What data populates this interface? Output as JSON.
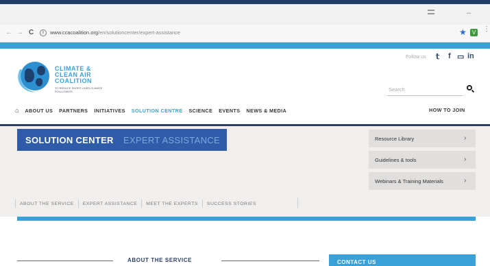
{
  "browser": {
    "url_domain": "www.ccacoalition.org",
    "url_path": "/en/solutioncenter/expert-assistance"
  },
  "site": {
    "follow_us": "Follow us",
    "logo": {
      "line1": "CLIMATE &",
      "line2": "CLEAN AIR",
      "line3": "COALITION",
      "tagline": "TO REDUCE SHORT-LIVED CLIMATE POLLUTANTS"
    },
    "search_placeholder": "Search",
    "nav": [
      "ABOUT US",
      "PARTNERS",
      "INITIATIVES",
      "SOLUTION CENTRE",
      "SCIENCE",
      "EVENTS",
      "NEWS & MEDIA"
    ],
    "how_to_join": "HOW TO JOIN"
  },
  "hero": {
    "title": "SOLUTION CENTER",
    "subtitle": "EXPERT ASSISTANCE"
  },
  "side_links": [
    "Resource Library",
    "Guidelines & tools",
    "Webinars & Training Materials"
  ],
  "subnav": [
    "ABOUT THE SERVICE",
    "EXPERT ASSISTANCE",
    "MEET THE EXPERTS",
    "SUCCESS STORIES"
  ],
  "section": {
    "about_heading": "ABOUT THE SERVICE",
    "contact_label": "CONTACT US"
  },
  "colors": {
    "accent": "#3aa0d8",
    "navy": "#2b3e6b",
    "banner": "#2e5ca8"
  }
}
